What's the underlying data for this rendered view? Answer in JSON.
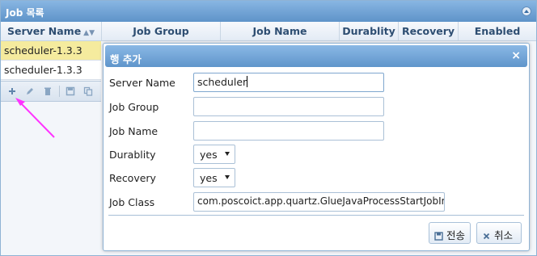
{
  "panel": {
    "title": "Job 목록",
    "columns": [
      {
        "label": "Server Name",
        "sort_icon": "▲▼"
      },
      {
        "label": "Job Group"
      },
      {
        "label": "Job Name"
      },
      {
        "label": "Durablity"
      },
      {
        "label": "Recovery"
      },
      {
        "label": "Enabled"
      }
    ],
    "rows": [
      {
        "server_name": "scheduler-1.3.3",
        "selected": true
      },
      {
        "server_name": "scheduler-1.3.3",
        "selected": false
      }
    ],
    "toolbar": [
      "add-icon",
      "edit-icon",
      "delete-icon",
      "save-icon",
      "copy-icon"
    ]
  },
  "dialog": {
    "title": "행 추가",
    "close": "×",
    "fields": {
      "server_name": {
        "label": "Server Name",
        "value": "scheduler"
      },
      "job_group": {
        "label": "Job Group",
        "value": ""
      },
      "job_name": {
        "label": "Job Name",
        "value": ""
      },
      "durablity": {
        "label": "Durablity",
        "value": "yes"
      },
      "recovery": {
        "label": "Recovery",
        "value": "yes"
      },
      "job_class": {
        "label": "Job Class",
        "value": "com.poscoict.app.quartz.GlueJavaProcessStartJobImp"
      }
    },
    "buttons": {
      "submit": "전송",
      "cancel": "취소"
    }
  },
  "colors": {
    "title_bar": "#5e93c9",
    "selected_row": "#f5eb9e",
    "annotation_arrow": "#ff33ff"
  }
}
